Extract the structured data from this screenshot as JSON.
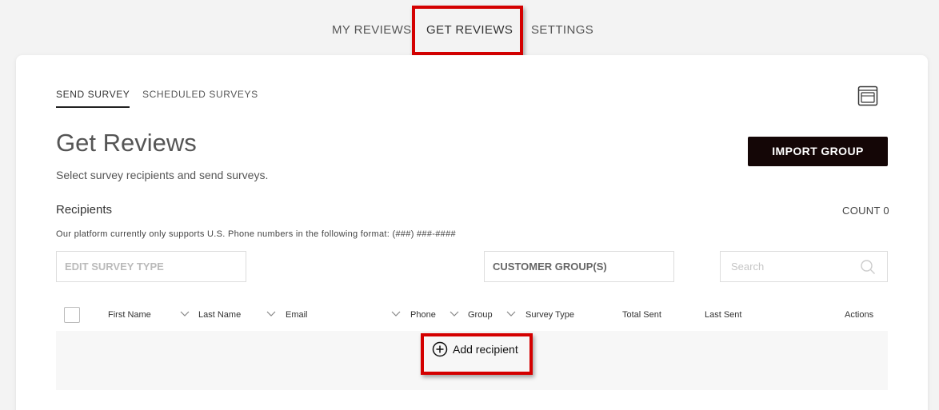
{
  "topnav": {
    "tabs": [
      {
        "label": "MY REVIEWS"
      },
      {
        "label": "GET REVIEWS"
      },
      {
        "label": "SETTINGS"
      }
    ]
  },
  "subtabs": [
    {
      "label": "SEND SURVEY"
    },
    {
      "label": "SCHEDULED SURVEYS"
    }
  ],
  "page": {
    "title": "Get Reviews",
    "subtitle": "Select survey recipients and send surveys.",
    "import_label": "IMPORT GROUP"
  },
  "recipients": {
    "label": "Recipients",
    "count": "COUNT 0",
    "phone_note": "Our platform currently only supports U.S. Phone numbers in the following format: (###) ###-####"
  },
  "filters": {
    "survey_type_placeholder": "EDIT SURVEY TYPE",
    "customer_group_placeholder": "CUSTOMER GROUP(S)",
    "search_placeholder": "Search"
  },
  "table": {
    "columns": [
      "First Name",
      "Last Name",
      "Email",
      "Phone",
      "Group",
      "Survey Type",
      "Total Sent",
      "Last Sent",
      "Actions"
    ],
    "add_label": "Add recipient"
  },
  "colors": {
    "highlight": "#d40000",
    "button_bg": "#140606"
  }
}
